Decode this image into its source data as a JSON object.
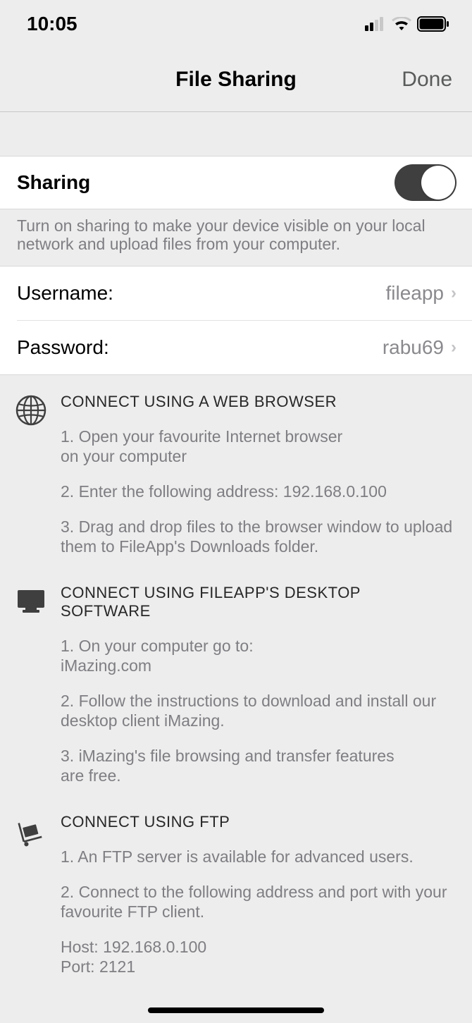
{
  "status": {
    "time": "10:05"
  },
  "nav": {
    "title": "File Sharing",
    "done": "Done"
  },
  "sharing_row": {
    "label": "Sharing",
    "on": true
  },
  "sharing_footer": "Turn on sharing to make your device visible on your local network and upload files from your computer.",
  "creds": {
    "username_label": "Username:",
    "username_value": "fileapp",
    "password_label": "Password:",
    "password_value": "rabu69"
  },
  "sections": [
    {
      "title": "CONNECT USING A WEB BROWSER",
      "steps": [
        "1. Open your favourite Internet browser on your computer",
        "2. Enter the following address: 192.168.0.100",
        "3. Drag and drop files to the browser window to upload them to FileApp's Downloads folder."
      ]
    },
    {
      "title": "CONNECT USING FILEAPP'S DESKTOP SOFTWARE",
      "steps": [
        "1. On your computer go to: iMazing.com",
        "2. Follow the instructions to download and install our desktop client iMazing.",
        "3. iMazing's file browsing and transfer features are free."
      ]
    },
    {
      "title": "CONNECT USING FTP",
      "steps": [
        "1. An FTP server is available for advanced users.",
        "2. Connect to the following address and port with your favourite FTP client."
      ],
      "host_label": "Host: 192.168.0.100",
      "port_label": "Port:  2121"
    }
  ]
}
